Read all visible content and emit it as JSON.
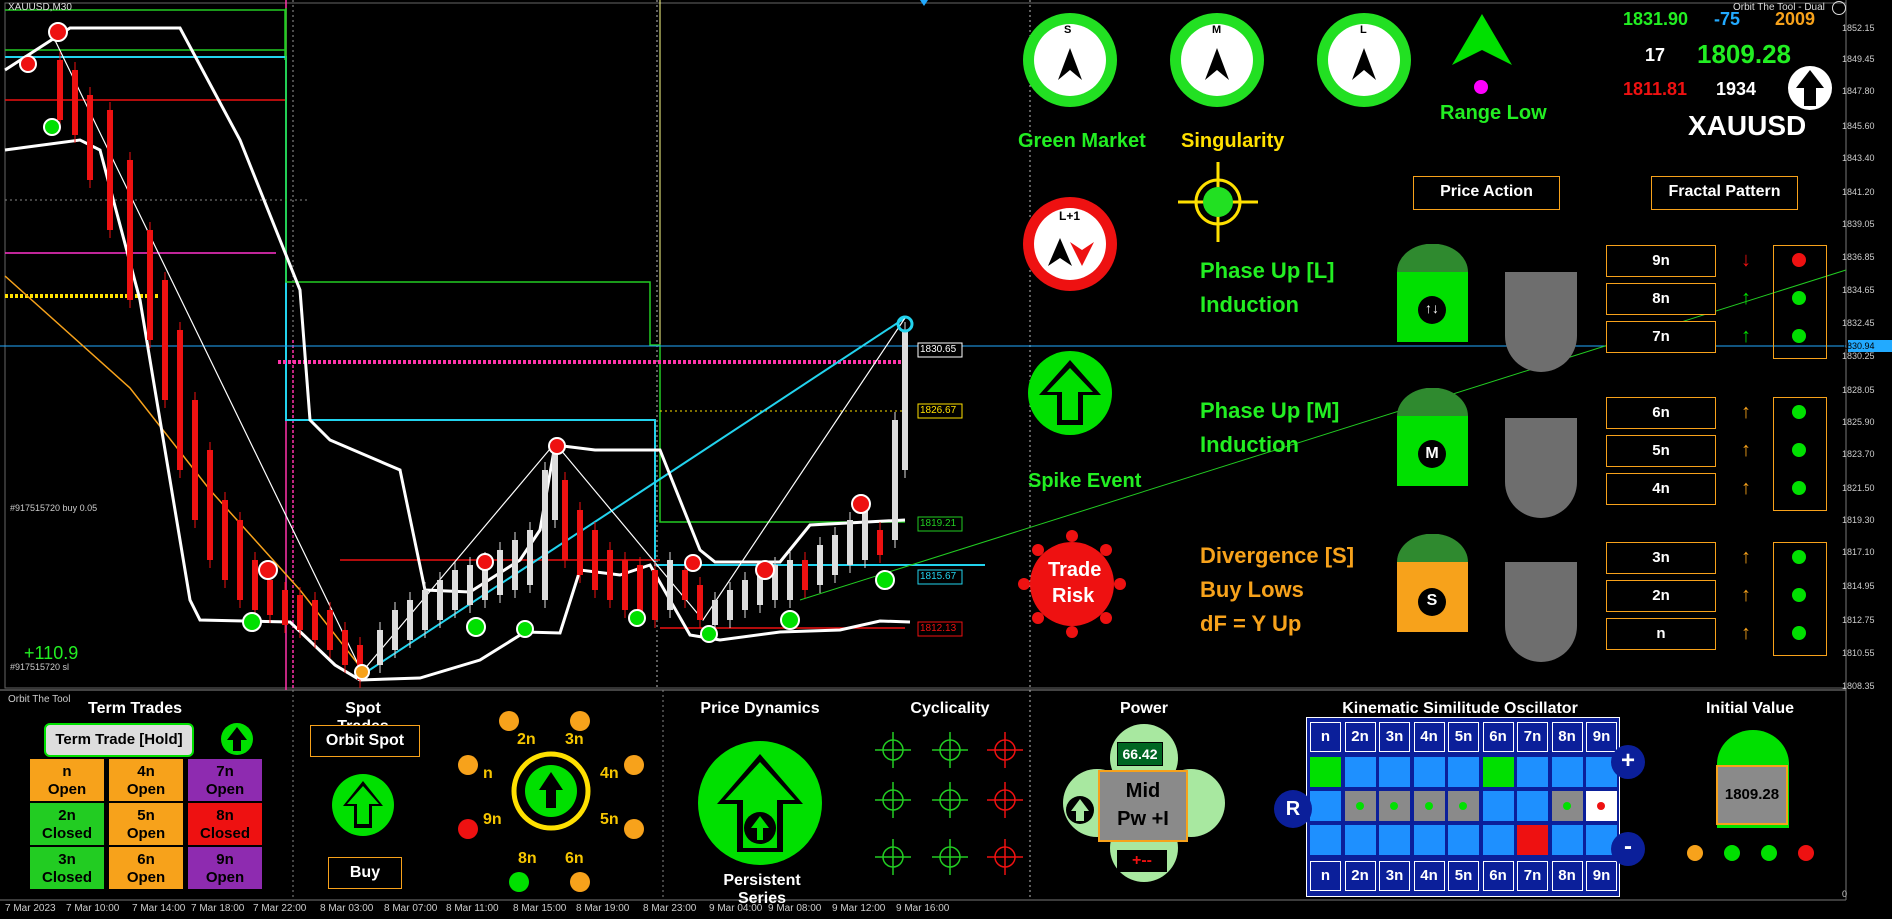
{
  "window": {
    "symbol_timeframe": "XAUUSD,M30",
    "indicator_title": "Orbit The Tool - Dual"
  },
  "price_scale": [
    "1852.15",
    "1849.45",
    "1847.80",
    "1845.60",
    "1843.40",
    "1841.20",
    "1839.05",
    "1836.85",
    "1834.65",
    "1832.45",
    "1830.94",
    "1830.25",
    "1828.05",
    "1825.90",
    "1823.70",
    "1821.50",
    "1819.30",
    "1817.10",
    "1814.95",
    "1812.75",
    "1810.55",
    "1808.35",
    "0"
  ],
  "time_axis": [
    "7 Mar 2023",
    "7 Mar 10:00",
    "7 Mar 14:00",
    "7 Mar 18:00",
    "7 Mar 22:00",
    "8 Mar 03:00",
    "8 Mar 07:00",
    "8 Mar 11:00",
    "8 Mar 15:00",
    "8 Mar 19:00",
    "8 Mar 23:00",
    "9 Mar 04:00",
    "9 Mar 08:00",
    "9 Mar 12:00",
    "9 Mar 16:00"
  ],
  "chart_levels": {
    "l1": "1830.65",
    "l2": "1826.67",
    "l3": "1819.21",
    "l4": "1815.67",
    "l5": "1812.13"
  },
  "order_labels": {
    "buy": "#917515720 buy 0.05",
    "sl": "#917515720 sl",
    "profit": "+110.9"
  },
  "gauges": {
    "s": "S",
    "m": "M",
    "l": "L",
    "lplus": "L+1"
  },
  "status_labels": {
    "green_market": "Green Market",
    "singularity": "Singularity",
    "range_low": "Range Low",
    "spike_event": "Spike Event",
    "trade_risk_1": "Trade",
    "trade_risk_2": "Risk"
  },
  "quotes": {
    "high": "1831.90",
    "change": "-75",
    "count": "2009",
    "index": "17",
    "price": "1809.28",
    "low": "1811.81",
    "bars": "1934",
    "symbol": "XAUUSD"
  },
  "buttons": {
    "price_action": "Price Action",
    "fractal_pattern": "Fractal Pattern"
  },
  "phases": {
    "l_title": "Phase Up [L]",
    "l_sub": "Induction",
    "m_title": "Phase Up [M]",
    "m_sub": "Induction",
    "s_title": "Divergence [S]",
    "s_sub1": "Buy Lows",
    "s_sub2": "dF = Y Up",
    "l_badge": "↑↓",
    "m_badge": "M",
    "s_badge": "S"
  },
  "fractal_rows": [
    "9n",
    "8n",
    "7n",
    "6n",
    "5n",
    "4n",
    "3n",
    "2n",
    "n"
  ],
  "panel": {
    "orbit_the_tool": "Orbit The Tool",
    "term_trades": "Term Trades",
    "term_trade_hold": "Term Trade [Hold]",
    "spot_trades": "Spot Trades",
    "orbit_spot": "Orbit Spot",
    "buy": "Buy",
    "price_dynamics": "Price Dynamics",
    "persistent_series": "Persistent Series",
    "cyclicality": "Cyclicality",
    "power": "Power",
    "power_value": "66.42",
    "power_mid": "Mid",
    "power_pw": "Pw +I",
    "power_signs": "+--",
    "kso_title": "Kinematic Similitude Oscillator",
    "initial_value": "Initial Value",
    "initial_price": "1809.28",
    "kso_r": "R",
    "kso_plus": "+",
    "kso_minus": "-"
  },
  "term_cells": [
    {
      "n": "n",
      "s": "Open",
      "color": "#f7a21b"
    },
    {
      "n": "4n",
      "s": "Open",
      "color": "#f7a21b"
    },
    {
      "n": "7n",
      "s": "Open",
      "color": "#8e2bb0"
    },
    {
      "n": "2n",
      "s": "Closed",
      "color": "#22cc22"
    },
    {
      "n": "5n",
      "s": "Open",
      "color": "#f7a21b"
    },
    {
      "n": "8n",
      "s": "Closed",
      "color": "#ee1111"
    },
    {
      "n": "3n",
      "s": "Closed",
      "color": "#22cc22"
    },
    {
      "n": "6n",
      "s": "Open",
      "color": "#f7a21b"
    },
    {
      "n": "9n",
      "s": "Open",
      "color": "#8e2bb0"
    }
  ],
  "orbit_labels": {
    "n2": "2n",
    "n3": "3n",
    "n": "n",
    "n4": "4n",
    "n9": "9n",
    "n5": "5n",
    "n8": "8n",
    "n6": "6n"
  },
  "kso_headers": [
    "n",
    "2n",
    "3n",
    "4n",
    "5n",
    "6n",
    "7n",
    "8n",
    "9n"
  ],
  "colors": {
    "green": "#00e000",
    "orange": "#f7a21b",
    "red": "#ee1111",
    "cyan": "#22d3ee"
  }
}
